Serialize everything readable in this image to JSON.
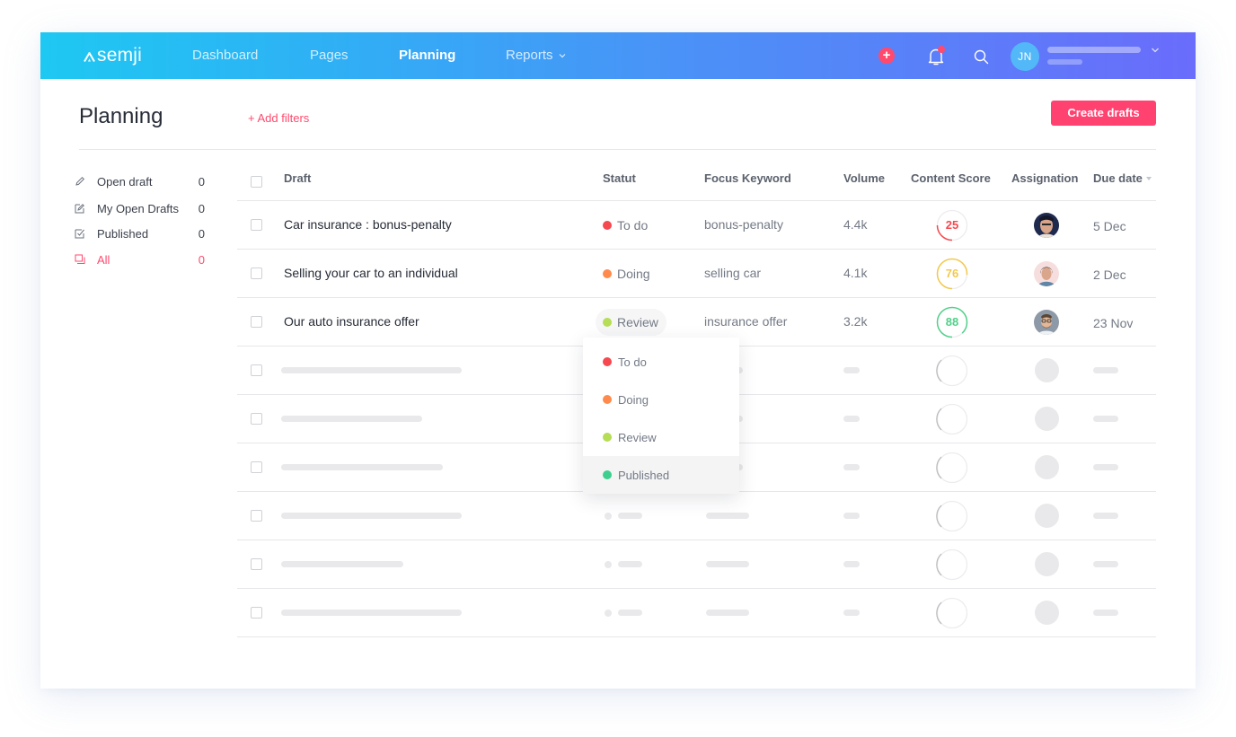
{
  "app": {
    "brand": "semji"
  },
  "navbar": {
    "items": [
      {
        "label": "Dashboard",
        "active": false
      },
      {
        "label": "Pages",
        "active": false
      },
      {
        "label": "Planning",
        "active": true
      },
      {
        "label": "Reports",
        "active": false,
        "has_dropdown": true
      }
    ],
    "actions": {
      "add_icon": "plus-circle-icon",
      "notifications_icon": "bell-icon",
      "notifications_badge": true,
      "search_icon": "search-icon"
    },
    "user": {
      "initials": "JN",
      "avatar_color": "#52b8f7"
    }
  },
  "header": {
    "title": "Planning",
    "add_filters_label": "+ Add filters",
    "create_button_label": "Create drafts"
  },
  "sidebar": {
    "items": [
      {
        "label": "Open draft",
        "count": "0",
        "icon": "pencil-icon",
        "active": false
      },
      {
        "label": "My Open Drafts",
        "count": "0",
        "icon": "edit-square-icon",
        "active": false
      },
      {
        "label": "Published",
        "count": "0",
        "icon": "check-square-icon",
        "active": false
      },
      {
        "label": "All",
        "count": "0",
        "icon": "copy-icon",
        "active": true
      }
    ]
  },
  "table": {
    "columns": [
      "Draft",
      "Statut",
      "Focus Keyword",
      "Volume",
      "Content Score",
      "Assignation",
      "Due date"
    ],
    "sorted_column": "Due date",
    "rows": [
      {
        "draft": "Car insurance : bonus-penalty",
        "status": "To do",
        "status_color": "#f5484f",
        "keyword": "bonus-penalty",
        "volume": "4.4k",
        "score": "25",
        "score_color": "#f5484f",
        "score_pct": 25,
        "assignee": "avatar-1",
        "due": "5 Dec"
      },
      {
        "draft": "Selling your car to an individual",
        "status": "Doing",
        "status_color": "#ff8a4c",
        "keyword": "selling car",
        "volume": "4.1k",
        "score": "76",
        "score_color": "#f2c94c",
        "score_pct": 76,
        "assignee": "avatar-2",
        "due": "2 Dec"
      },
      {
        "draft": "Our auto insurance offer",
        "status": "Review",
        "status_color": "#b5dd55",
        "keyword": "insurance offer",
        "volume": "3.2k",
        "score": "88",
        "score_color": "#52d08a",
        "score_pct": 88,
        "assignee": "avatar-3",
        "due": "23 Nov"
      }
    ],
    "placeholder_rows": 6
  },
  "status_dropdown": {
    "options": [
      {
        "label": "To do",
        "color": "#f5484f"
      },
      {
        "label": "Doing",
        "color": "#ff8a4c"
      },
      {
        "label": "Review",
        "color": "#b5dd55"
      },
      {
        "label": "Published",
        "color": "#3ecf8e",
        "hovered": true
      }
    ]
  }
}
